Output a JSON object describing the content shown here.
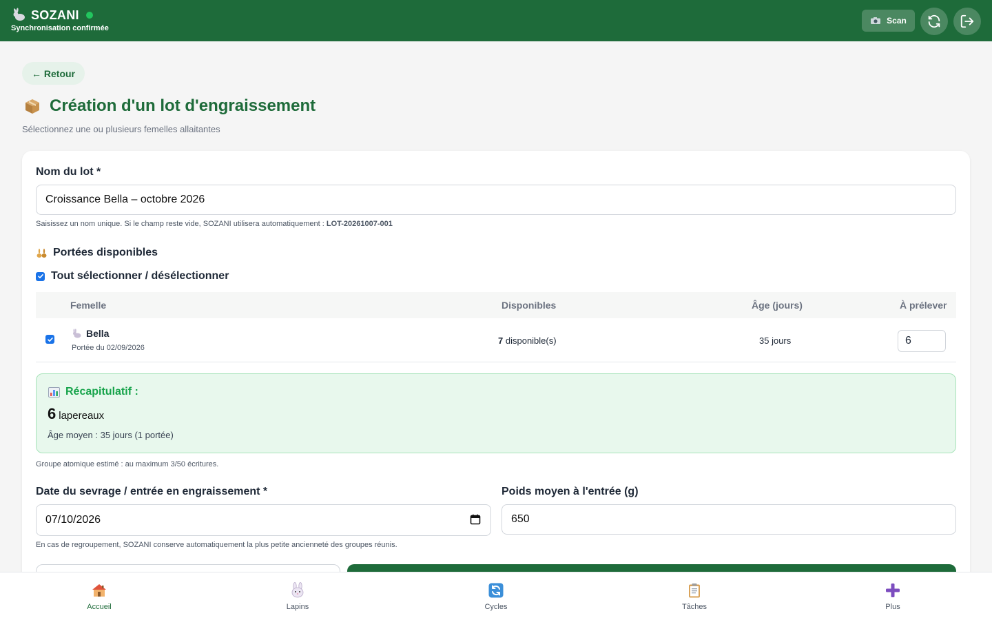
{
  "header": {
    "brand": "SOZANI",
    "sync_status": "Synchronisation confirmée",
    "scan_label": "Scan"
  },
  "back_label": "← Retour",
  "title": "Création d'un lot d'engraissement",
  "subtitle": "Sélectionnez une ou plusieurs femelles allaitantes",
  "lot_name": {
    "label": "Nom du lot *",
    "value": "Croissance Bella – octobre 2026",
    "hint_prefix": "Saisissez un nom unique. Si le champ reste vide, SOZANI utilisera automatiquement :",
    "hint_code": "LOT-20261007-001"
  },
  "litters": {
    "section_title": "Portées disponibles",
    "select_all_label": "Tout sélectionner / désélectionner",
    "columns": [
      "Femelle",
      "Disponibles",
      "Âge (jours)",
      "À prélever"
    ],
    "rows": [
      {
        "name": "Bella",
        "litter_date": "Portée du 02/09/2026",
        "available_count": "7",
        "available_suffix": "disponible(s)",
        "age": "35 jours",
        "to_take": "6"
      }
    ]
  },
  "recap": {
    "title": "Récapitulatif :",
    "count": "6",
    "count_unit": "lapereaux",
    "avg_age": "Âge moyen : 35 jours (1 portée)"
  },
  "atomic_hint": "Groupe atomique estimé : au maximum 3/50 écritures.",
  "weaning": {
    "label": "Date du sevrage / entrée en engraissement *",
    "value": "07/10/2026",
    "hint": "En cas de regroupement, SOZANI conserve automatiquement la plus petite ancienneté des groupes réunis."
  },
  "weight": {
    "label": "Poids moyen à l'entrée (g)",
    "value": "650"
  },
  "nav": [
    "Accueil",
    "Lapins",
    "Cycles",
    "Tâches",
    "Plus"
  ],
  "colors": {
    "primary": "#1e6b3a",
    "status_ok": "#22c55e",
    "recap_bg": "#e8f8ed",
    "checkbox": "#1a73e8"
  }
}
